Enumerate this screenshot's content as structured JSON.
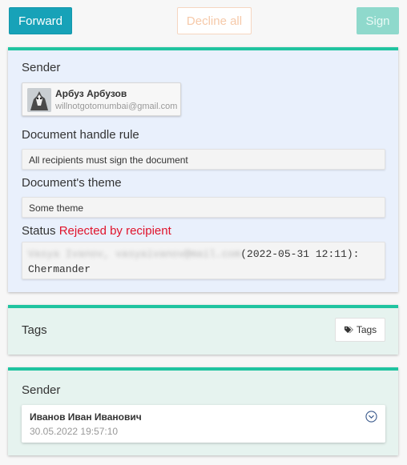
{
  "toolbar": {
    "forward_label": "Forward",
    "decline_label": "Decline all",
    "sign_label": "Sign"
  },
  "document": {
    "sender_title": "Sender",
    "sender": {
      "name": "Арбуз Арбузов",
      "email": "willnotgotomumbai@gmail.com"
    },
    "handle_rule_title": "Document handle rule",
    "handle_rule_value": "All recipients must sign the document",
    "theme_title": "Document's theme",
    "theme_value": "Some theme",
    "status_title": "Status",
    "status_value": "Rejected by recipient",
    "status_log": {
      "redacted": "Vasya Ivanov, vasyaivanov@mail.com",
      "timestamp": "(2022-05-31 12:11):",
      "comment": "Chermander"
    }
  },
  "tags": {
    "title": "Tags",
    "button_label": "Tags"
  },
  "history": {
    "sender_title": "Sender",
    "entry": {
      "name": "Иванов Иван Иванович",
      "date": "30.05.2022 19:57:10"
    }
  },
  "colors": {
    "accent": "#20c4a0",
    "primary": "#17a2b8",
    "danger": "#e0132b"
  }
}
